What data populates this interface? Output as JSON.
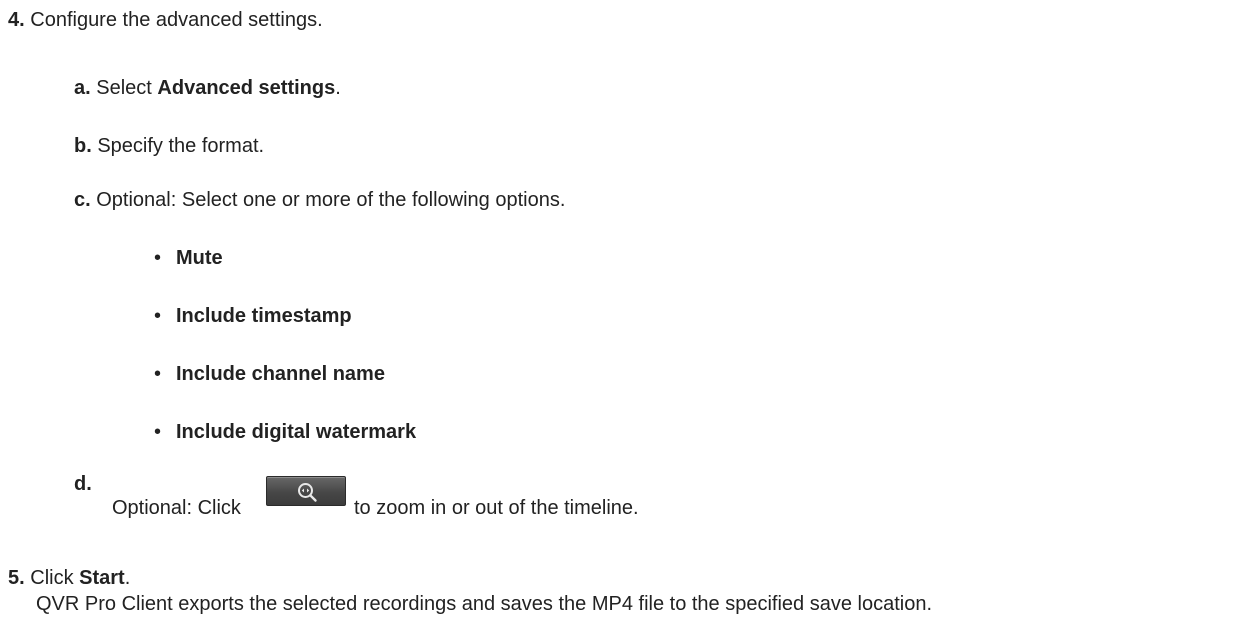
{
  "steps": {
    "s4": {
      "number": "4.",
      "text": "Configure the advanced settings.",
      "a": {
        "letter": "a.",
        "pre": "Select ",
        "bold": "Advanced settings",
        "post": "."
      },
      "b": {
        "letter": "b.",
        "text": "Specify the format."
      },
      "c": {
        "letter": "c.",
        "text": "Optional: Select one or more of the following options.",
        "bullet": "•",
        "options": [
          "Mute",
          "Include timestamp",
          "Include channel name",
          "Include digital watermark"
        ]
      },
      "d": {
        "letter": "d.",
        "pre": "Optional: Click",
        "post": "to zoom in or out of the timeline.",
        "icon": "zoom-timeline-icon"
      }
    },
    "s5": {
      "number": "5.",
      "pre": "Click ",
      "bold": "Start",
      "post": ".",
      "detail": "QVR Pro Client exports the selected recordings and saves the MP4 file to the specified save location."
    }
  }
}
